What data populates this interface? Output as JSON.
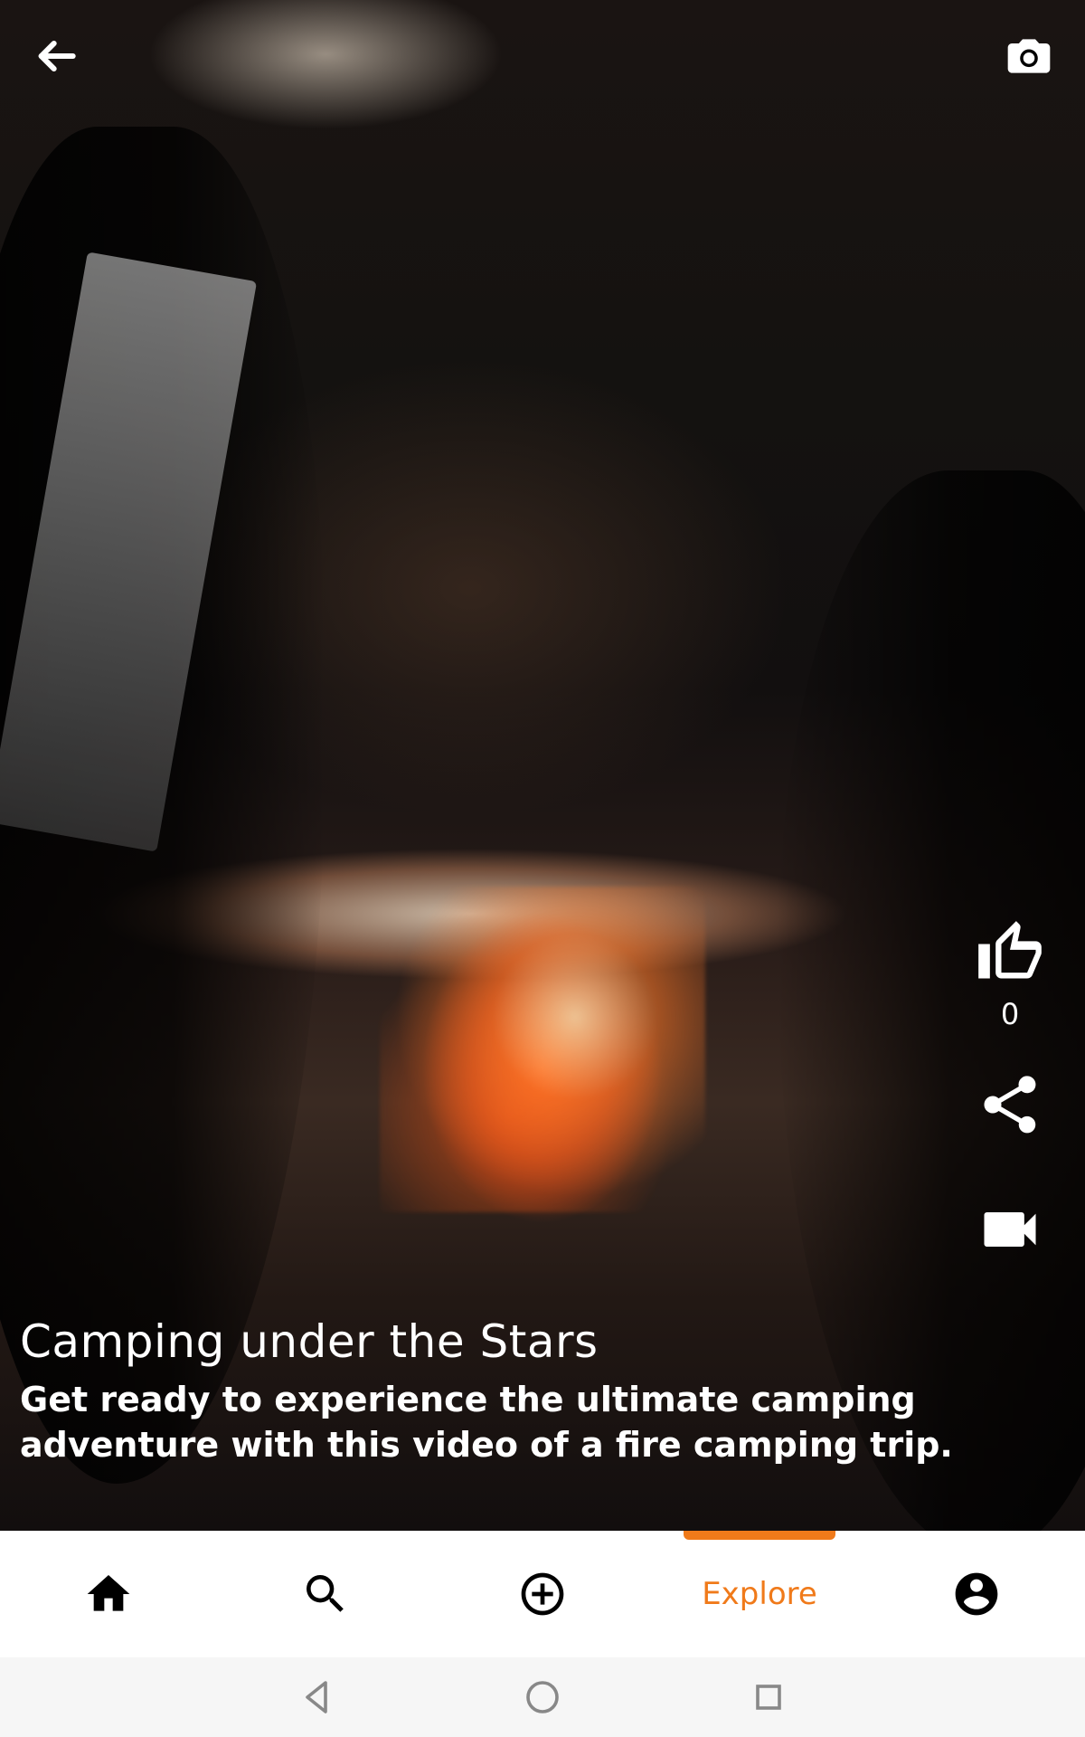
{
  "video": {
    "title": "Camping under the Stars",
    "description": "Get ready to experience the ultimate camping adventure with this video of a fire camping trip.",
    "likes": "0"
  },
  "top_bar": {
    "back_icon": "arrow-left-icon",
    "camera_icon": "camera-icon"
  },
  "actions": {
    "like_icon": "thumb-up-icon",
    "share_icon": "share-icon",
    "video_icon": "videocam-icon"
  },
  "bottom_nav": {
    "items": [
      {
        "id": "home",
        "icon": "home-icon",
        "label": ""
      },
      {
        "id": "search",
        "icon": "search-icon",
        "label": ""
      },
      {
        "id": "add",
        "icon": "add-circle-icon",
        "label": ""
      },
      {
        "id": "explore",
        "icon": "",
        "label": "Explore"
      },
      {
        "id": "profile",
        "icon": "account-icon",
        "label": ""
      }
    ],
    "active": "explore",
    "accent": "#F07A1A"
  },
  "system_nav": {
    "back_icon": "system-back-icon",
    "home_icon": "system-home-icon",
    "recents_icon": "system-recents-icon"
  }
}
